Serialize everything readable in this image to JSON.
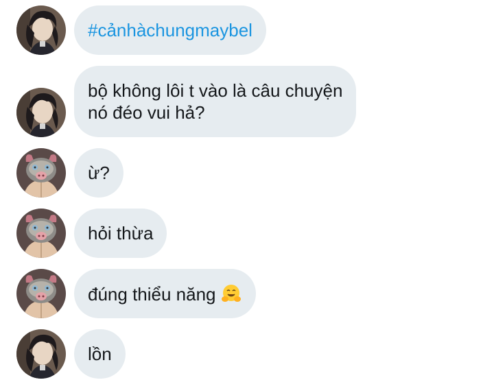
{
  "messages": [
    {
      "avatar": "dark-haired-man-avatar",
      "text": "#cảnhàchungmaybel",
      "hashtag": true
    },
    {
      "avatar": "dark-haired-man-avatar",
      "lines": [
        "bộ không lôi t vào là câu chuyện",
        "nó đéo vui hả?"
      ]
    },
    {
      "avatar": "boar-mask-avatar",
      "text": "ừ?"
    },
    {
      "avatar": "boar-mask-avatar",
      "text": "hỏi thừa"
    },
    {
      "avatar": "boar-mask-avatar",
      "text": "đúng thiểu năng",
      "emoji": "hugging-face-emoji"
    },
    {
      "avatar": "dark-haired-man-avatar",
      "text": "lồn"
    }
  ],
  "colors": {
    "bubble_bg": "#e6ecf0",
    "text": "#14171a",
    "hashtag": "#1b95e0"
  }
}
